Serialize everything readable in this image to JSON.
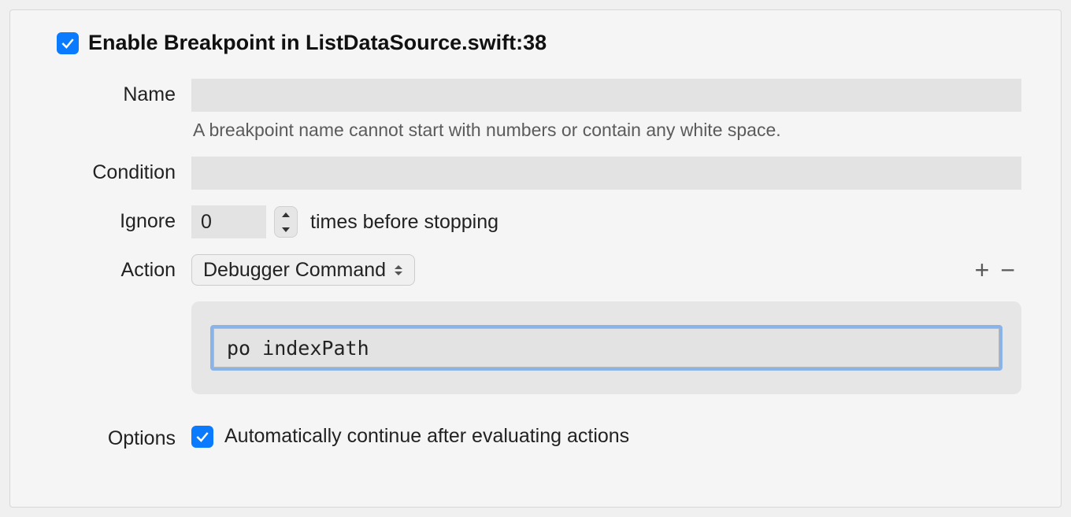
{
  "header": {
    "enable_checked": true,
    "title": "Enable Breakpoint in ListDataSource.swift:38"
  },
  "name_field": {
    "label": "Name",
    "value": "",
    "hint": "A breakpoint name cannot start with numbers or contain any white space."
  },
  "condition_field": {
    "label": "Condition",
    "value": ""
  },
  "ignore_field": {
    "label": "Ignore",
    "value": "0",
    "suffix": "times before stopping"
  },
  "action_field": {
    "label": "Action",
    "selected": "Debugger Command",
    "command": "po indexPath"
  },
  "options_field": {
    "label": "Options",
    "auto_continue_checked": true,
    "auto_continue_label": "Automatically continue after evaluating actions"
  }
}
